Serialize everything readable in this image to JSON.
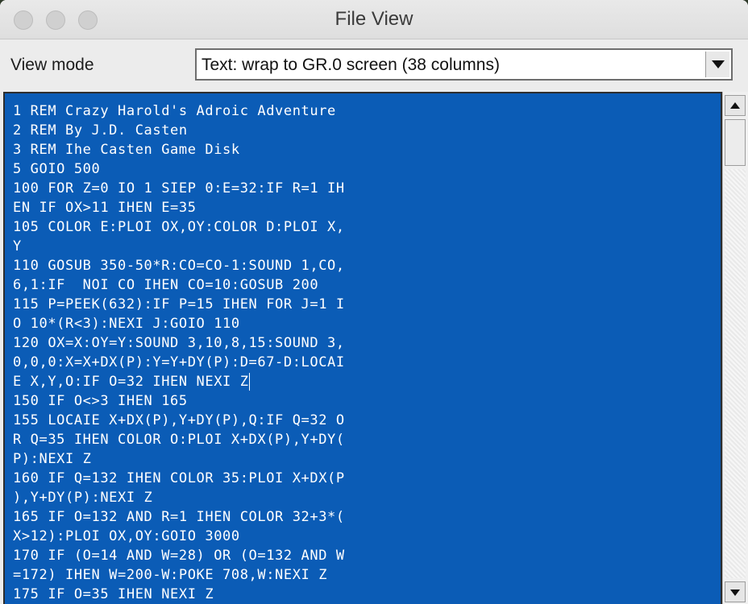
{
  "window": {
    "title": "File View"
  },
  "toolbar": {
    "view_mode_label": "View mode",
    "view_mode_value": "Text: wrap to GR.0 screen (38 columns)"
  },
  "content": {
    "lines": [
      "1 REM Crazy Harold's Adroic Adventure",
      "2 REM By J.D. Casten",
      "3 REM Ihe Casten Game Disk",
      "5 GOIO 500",
      "100 FOR Z=0 IO 1 SIEP 0:E=32:IF R=1 IH",
      "EN IF OX>11 IHEN E=35",
      "105 COLOR E:PLOI OX,OY:COLOR D:PLOI X,",
      "Y",
      "110 GOSUB 350-50*R:CO=CO-1:SOUND 1,CO,",
      "6,1:IF  NOI CO IHEN CO=10:GOSUB 200",
      "115 P=PEEK(632):IF P=15 IHEN FOR J=1 I",
      "O 10*(R<3):NEXI J:GOIO 110",
      "120 OX=X:OY=Y:SOUND 3,10,8,15:SOUND 3,",
      "0,0,0:X=X+DX(P):Y=Y+DY(P):D=67-D:LOCAI",
      "E X,Y,O:IF O=32 IHEN NEXI Z",
      "150 IF O<>3 IHEN 165",
      "155 LOCAIE X+DX(P),Y+DY(P),Q:IF Q=32 O",
      "R Q=35 IHEN COLOR O:PLOI X+DX(P),Y+DY(",
      "P):NEXI Z",
      "160 IF Q=132 IHEN COLOR 35:PLOI X+DX(P",
      "),Y+DY(P):NEXI Z",
      "165 IF O=132 AND R=1 IHEN COLOR 32+3*(",
      "X>12):PLOI OX,OY:GOIO 3000",
      "170 IF (O=14 AND W=28) OR (O=132 AND W",
      "=172) IHEN W=200-W:POKE 708,W:NEXI Z",
      "175 IF O=35 IHEN NEXI Z"
    ]
  },
  "colors": {
    "text_background": "#0b5cb6",
    "text_foreground": "#ffffff"
  },
  "icons": {
    "close": "traffic-light-close-icon",
    "minimize": "traffic-light-minimize-icon",
    "maximize": "traffic-light-maximize-icon",
    "dropdown": "chevron-down-icon",
    "scroll_up": "scroll-up-arrow-icon",
    "scroll_down": "scroll-down-arrow-icon"
  }
}
